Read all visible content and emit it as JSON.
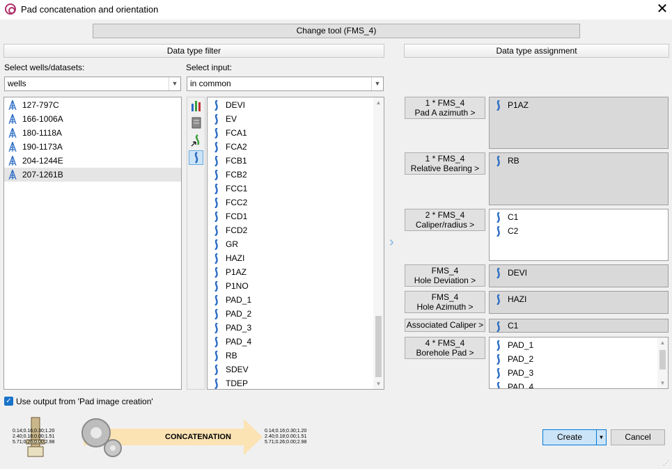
{
  "window": {
    "title": "Pad concatenation and orientation"
  },
  "change_tool_label": "Change tool (FMS_4)",
  "filter_header": "Data type filter",
  "assignment_header": "Data type assignment",
  "wells_label": "Select wells/datasets:",
  "wells_combo": "wells",
  "input_label": "Select input:",
  "input_combo": "in common",
  "wells": [
    "127-797C",
    "166-1006A",
    "180-1118A",
    "190-1173A",
    "204-1244E",
    "207-1261B"
  ],
  "selected_well_index": 5,
  "curves": [
    "DEVI",
    "EV",
    "FCA1",
    "FCA2",
    "FCB1",
    "FCB2",
    "FCC1",
    "FCC2",
    "FCD1",
    "FCD2",
    "GR",
    "HAZI",
    "P1AZ",
    "P1NO",
    "PAD_1",
    "PAD_2",
    "PAD_3",
    "PAD_4",
    "RB",
    "SDEV",
    "TDEP"
  ],
  "assignments": [
    {
      "line1": "1 * FMS_4",
      "line2": "Pad A azimuth >",
      "values": [
        "P1AZ"
      ]
    },
    {
      "line1": "1 * FMS_4",
      "line2": "Relative Bearing >",
      "values": [
        "RB"
      ]
    },
    {
      "line1": "2 * FMS_4",
      "line2": "Caliper/radius >",
      "values": [
        "C1",
        "C2"
      ]
    },
    {
      "line1": "FMS_4",
      "line2": "Hole Deviation >",
      "values": [
        "DEVI"
      ]
    },
    {
      "line1": "FMS_4",
      "line2": "Hole Azimuth >",
      "values": [
        "HAZI"
      ]
    },
    {
      "line1": "Associated Caliper >",
      "line2": "",
      "values": [
        "C1"
      ]
    },
    {
      "line1": "4 * FMS_4",
      "line2": "Borehole Pad >",
      "values": [
        "PAD_1",
        "PAD_2",
        "PAD_3",
        "PAD_4"
      ]
    }
  ],
  "use_output_label": "Use output from 'Pad image creation'",
  "use_output_checked": true,
  "banner": {
    "label": "CONCATENATION",
    "left_values": [
      "0.14;0.16;0.30;1.20",
      "2.40;0.18;0.00;1.51",
      "5.71;0.26;0.00;2.98"
    ],
    "right_values": [
      "0.14;0.16;0.30;1.20",
      "2.40;0.18;0.00;1.51",
      "5.71;0.26;0.00;2.98"
    ]
  },
  "create_label": "Create",
  "cancel_label": "Cancel",
  "colors": {
    "accent": "#1a73c9",
    "curve_icon": "#2b6cc4",
    "banner": "#fbe3b3"
  }
}
